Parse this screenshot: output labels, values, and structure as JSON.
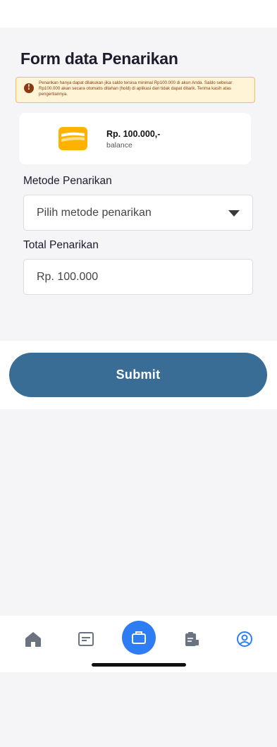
{
  "header": {
    "title": "Form data Penarikan"
  },
  "notice": {
    "icon": "info-icon",
    "text": "Penarikan hanya dapat dilakukan jika saldo tersisa minimal Rp100.000 di akun Anda. Saldo sebesar Rp100.000 akan secara otomatis ditahan (hold) di aplikasi dan tidak dapat ditarik. Terima kasih atas pengertiannya."
  },
  "balance": {
    "amount": "Rp. 100.000,-",
    "label": "balance",
    "icon": "wallet-icon"
  },
  "form": {
    "method_label": "Metode Penarikan",
    "method_placeholder": "Pilih metode penarikan",
    "total_label": "Total Penarikan",
    "total_placeholder": "Rp. 100.000"
  },
  "actions": {
    "submit_label": "Submit"
  },
  "nav": {
    "items": [
      {
        "icon": "home-icon"
      },
      {
        "icon": "news-icon"
      },
      {
        "icon": "briefcase-icon",
        "active": true
      },
      {
        "icon": "report-icon"
      },
      {
        "icon": "profile-icon"
      }
    ]
  },
  "colors": {
    "primary_button": "#3a6d96",
    "nav_active": "#2f7df4",
    "notice_bg": "#fff4d6",
    "notice_text": "#8b3a0f",
    "wallet": "#ffb300"
  }
}
